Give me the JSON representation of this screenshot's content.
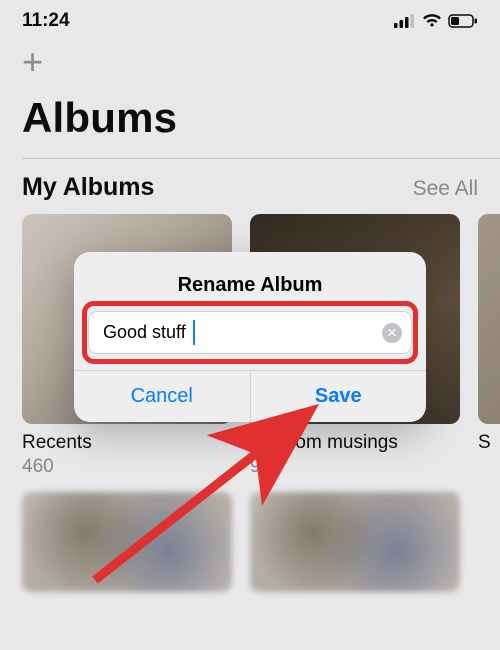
{
  "status": {
    "time": "11:24"
  },
  "header": {
    "add_symbol": "+",
    "title": "Albums"
  },
  "section": {
    "title": "My Albums",
    "see_all": "See All"
  },
  "albums": [
    {
      "name": "Recents",
      "count": "460"
    },
    {
      "name": "Random musings",
      "count": "9"
    },
    {
      "name": "S",
      "count": ""
    }
  ],
  "modal": {
    "title": "Rename Album",
    "input_value": "Good stuff",
    "clear_symbol": "✕",
    "cancel": "Cancel",
    "save": "Save"
  }
}
